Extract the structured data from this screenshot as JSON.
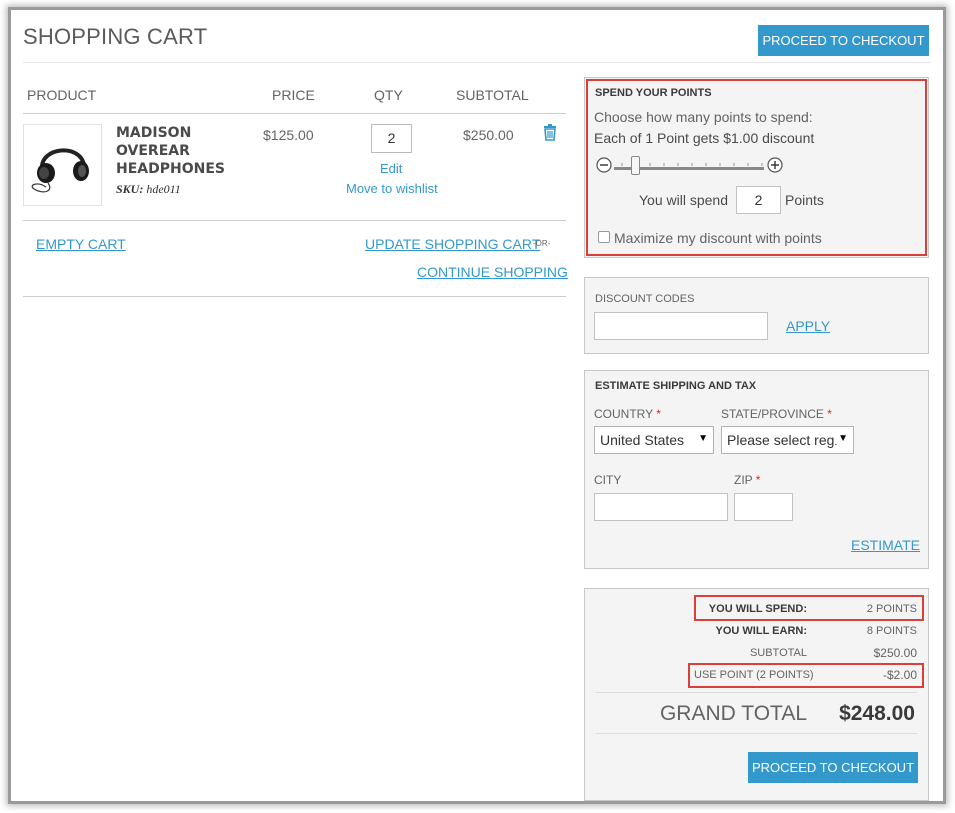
{
  "page": {
    "title": "SHOPPING CART"
  },
  "header": {
    "checkout_label": "PROCEED TO CHECKOUT"
  },
  "cart": {
    "columns": {
      "product": "PRODUCT",
      "price": "PRICE",
      "qty": "QTY",
      "subtotal": "SUBTOTAL"
    },
    "item": {
      "name_line1": "MADISON",
      "name_line2": "OVEREAR",
      "name_line3": "HEADPHONES",
      "sku_label": "SKU:",
      "sku_value": "hde011",
      "price": "$125.00",
      "qty": "2",
      "subtotal": "$250.00",
      "edit_label": "Edit",
      "wishlist_label": "Move to wishlist",
      "delete_icon": "trash-icon"
    },
    "empty_label": "EMPTY CART",
    "update_label": "UPDATE SHOPPING CART",
    "or_label": "-OR-",
    "continue_label": "CONTINUE SHOPPING"
  },
  "points": {
    "title": "SPEND YOUR POINTS",
    "prompt": "Choose how many points to spend:",
    "rate": "Each of 1 Point gets $1.00 discount",
    "slider_min_icon": "minus-circle-icon",
    "slider_max_icon": "plus-circle-icon",
    "slider_level": 0.1,
    "spend_prefix": "You will spend",
    "spend_value": "2",
    "spend_suffix": "Points",
    "maximize_label": "Maximize my discount with points",
    "maximize_checked": false
  },
  "discount": {
    "title": "DISCOUNT CODES",
    "code_value": "",
    "apply_label": "APPLY"
  },
  "shipping": {
    "title": "ESTIMATE SHIPPING AND TAX",
    "country_label": "COUNTRY",
    "country_value": "United States",
    "state_label": "STATE/PROVINCE",
    "state_value": "Please select regi",
    "required_mark": "*",
    "city_label": "CITY",
    "city_value": "",
    "zip_label": "ZIP",
    "zip_value": "",
    "estimate_label": "ESTIMATE"
  },
  "totals": {
    "spend_label": "YOU WILL SPEND:",
    "spend_value": "2 POINTS",
    "earn_label": "YOU WILL EARN:",
    "earn_value": "8 POINTS",
    "subtotal_label": "SUBTOTAL",
    "subtotal_value": "$250.00",
    "use_point_label": "USE POINT (2 POINTS)",
    "use_point_value": "-$2.00",
    "grand_total_label": "GRAND TOTAL",
    "grand_total_value": "$248.00",
    "checkout_label": "PROCEED TO CHECKOUT"
  },
  "colors": {
    "accent": "#3399cc",
    "highlight": "#d9403a",
    "panel_bg": "#f4f4f4"
  }
}
